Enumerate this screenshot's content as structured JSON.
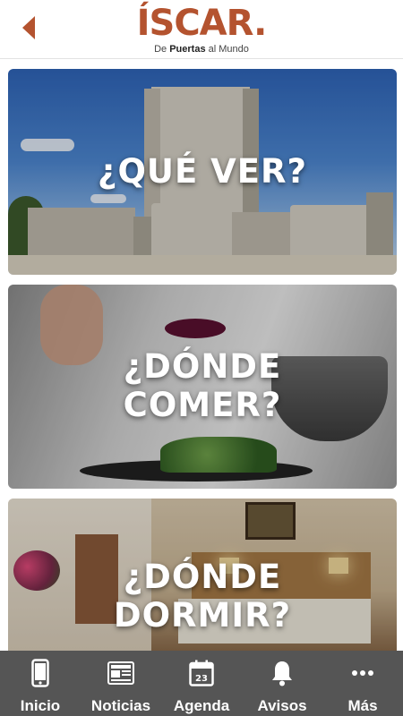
{
  "header": {
    "logo_title": "ÍSCAR.",
    "logo_sub_prefix": "De",
    "logo_sub_bold": "Puertas",
    "logo_sub_suffix": "al Mundo",
    "back_icon": "chevron-left-icon",
    "accent_color": "#b4532f"
  },
  "cards": [
    {
      "label": "¿QUÉ VER?",
      "image": "castle-photo"
    },
    {
      "label_line1": "¿DÓNDE",
      "label_line2": "COMER?",
      "image": "chef-plating-photo"
    },
    {
      "label_line1": "¿DÓNDE",
      "label_line2": "DORMIR?",
      "image": "hotel-room-photo"
    }
  ],
  "nav": {
    "background": "#555555",
    "items": [
      {
        "label": "Inicio",
        "icon": "smartphone-icon"
      },
      {
        "label": "Noticias",
        "icon": "newspaper-icon"
      },
      {
        "label": "Agenda",
        "icon": "calendar-icon",
        "icon_text": "23"
      },
      {
        "label": "Avisos",
        "icon": "bell-icon"
      },
      {
        "label": "Más",
        "icon": "more-dots-icon"
      }
    ]
  }
}
